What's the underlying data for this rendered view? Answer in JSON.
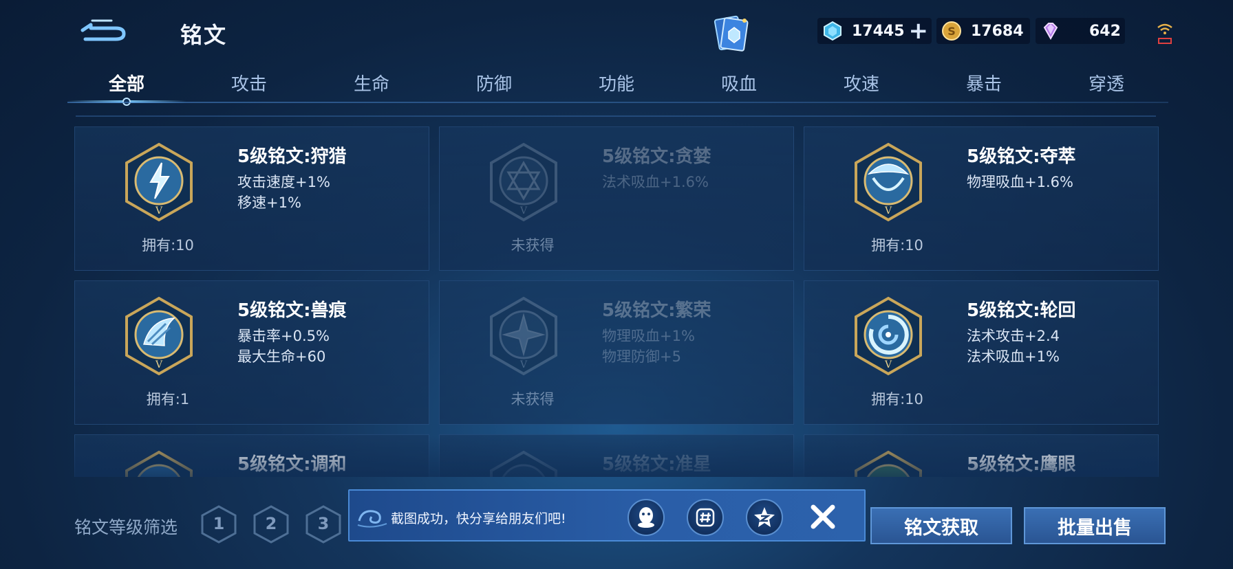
{
  "header": {
    "title": "铭文",
    "currencies": [
      {
        "name": "diamond",
        "value": "17445"
      },
      {
        "name": "gold",
        "value": "17684"
      },
      {
        "name": "gem",
        "value": "642"
      }
    ]
  },
  "tabs": [
    "全部",
    "攻击",
    "生命",
    "防御",
    "功能",
    "吸血",
    "攻速",
    "暴击",
    "穿透"
  ],
  "cards": [
    {
      "name": "5级铭文:狩猎",
      "attrs": [
        "攻击速度+1%",
        "移速+1%"
      ],
      "owned": "拥有:10",
      "locked": false,
      "icon": "hunt-emblem-icon"
    },
    {
      "name": "5级铭文:贪婪",
      "attrs": [
        "法术吸血+1.6%",
        ""
      ],
      "owned": "未获得",
      "locked": true,
      "icon": "greed-emblem-icon"
    },
    {
      "name": "5级铭文:夺萃",
      "attrs": [
        "物理吸血+1.6%",
        ""
      ],
      "owned": "拥有:10",
      "locked": false,
      "icon": "seize-emblem-icon"
    },
    {
      "name": "5级铭文:兽痕",
      "attrs": [
        "暴击率+0.5%",
        "最大生命+60"
      ],
      "owned": "拥有:1",
      "locked": false,
      "icon": "beast-mark-emblem-icon"
    },
    {
      "name": "5级铭文:繁荣",
      "attrs": [
        "物理吸血+1%",
        "物理防御+5"
      ],
      "owned": "未获得",
      "locked": true,
      "icon": "prosperity-emblem-icon"
    },
    {
      "name": "5级铭文:轮回",
      "attrs": [
        "法术攻击+2.4",
        "法术吸血+1%"
      ],
      "owned": "拥有:10",
      "locked": false,
      "icon": "reincarnation-emblem-icon"
    },
    {
      "name": "5级铭文:调和",
      "attrs": [
        "",
        ""
      ],
      "owned": "",
      "locked": false,
      "icon": "harmony-emblem-icon"
    },
    {
      "name": "5级铭文:准星",
      "attrs": [
        "",
        ""
      ],
      "owned": "",
      "locked": true,
      "icon": "crosshair-emblem-icon"
    },
    {
      "name": "5级铭文:鹰眼",
      "attrs": [
        "",
        ""
      ],
      "owned": "",
      "locked": false,
      "icon": "eagle-eye-emblem-icon"
    }
  ],
  "filter": {
    "label": "铭文等级筛选",
    "levels": [
      "1",
      "2",
      "3"
    ]
  },
  "toast": {
    "text": "截图成功，快分享给朋友们吧!"
  },
  "buttons": {
    "obtain": "铭文获取",
    "sell": "批量出售"
  }
}
